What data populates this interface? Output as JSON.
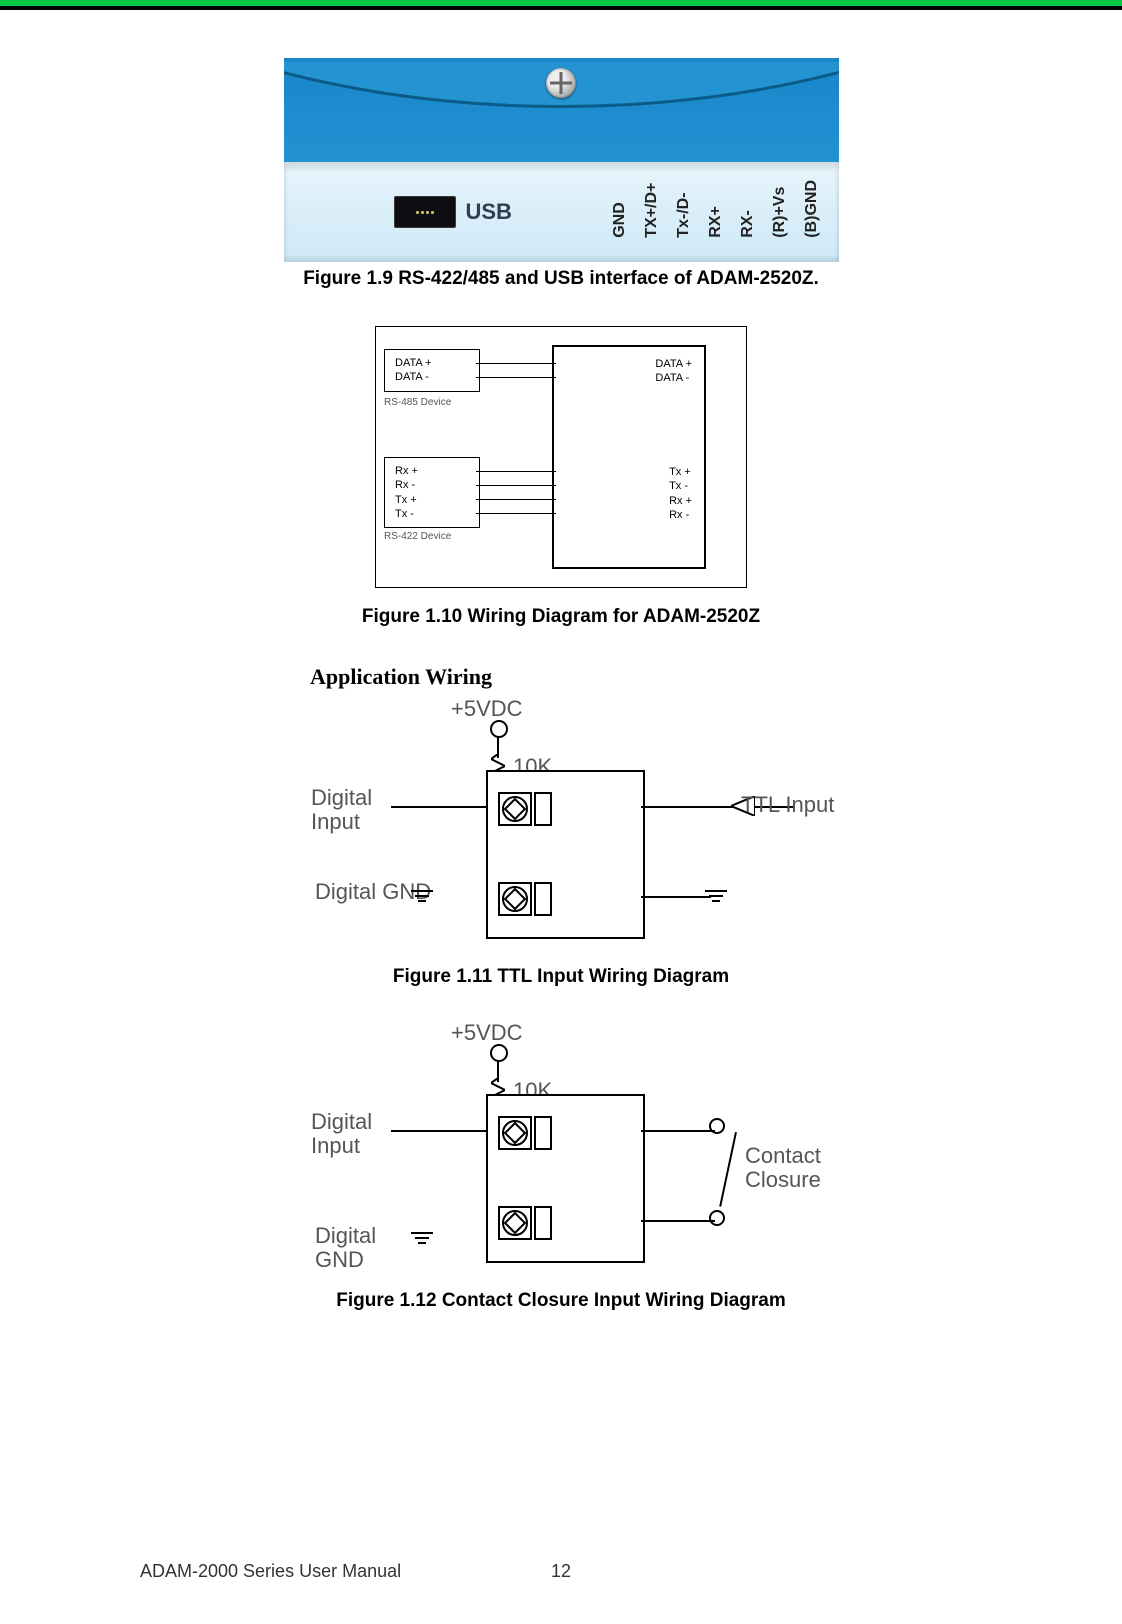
{
  "topfigure": {
    "usb_label": "USB",
    "pins": [
      "GND",
      "TX+/D+",
      "Tx-/D-",
      "RX+",
      "RX-",
      "(R)+Vs",
      "(B)GND"
    ],
    "caption": "Figure 1.9 RS-422/485 and USB interface of ADAM-2520Z."
  },
  "fig10": {
    "caption": "Figure 1.10 Wiring Diagram for ADAM-2520Z",
    "left_top": [
      "DATA +",
      "DATA -"
    ],
    "left_top_under": "RS-485 Device",
    "left_bot": [
      "Rx +",
      "Rx -",
      "Tx +",
      "Tx -"
    ],
    "left_bot_under": "RS-422 Device",
    "right_top": [
      "DATA +",
      "DATA -"
    ],
    "right_bot": [
      "Tx +",
      "Tx -",
      "Rx +",
      "Rx -"
    ]
  },
  "appwiring_title": "Application Wiring",
  "fig11": {
    "caption": "Figure 1.11 TTL Input Wiring Diagram",
    "vcc": "+5VDC",
    "res": "10K",
    "din": "Digital Input",
    "dgnd": "Digital GND",
    "right": "TTL  Input"
  },
  "fig12": {
    "caption": "Figure 1.12 Contact Closure Input Wiring Diagram",
    "vcc": "+5VDC",
    "res": "10K",
    "din": "Digital Input",
    "dgnd": "Digital GND",
    "right": "Contact Closure"
  },
  "footer": {
    "manual": "ADAM-2000 Series User Manual",
    "page": "12"
  }
}
